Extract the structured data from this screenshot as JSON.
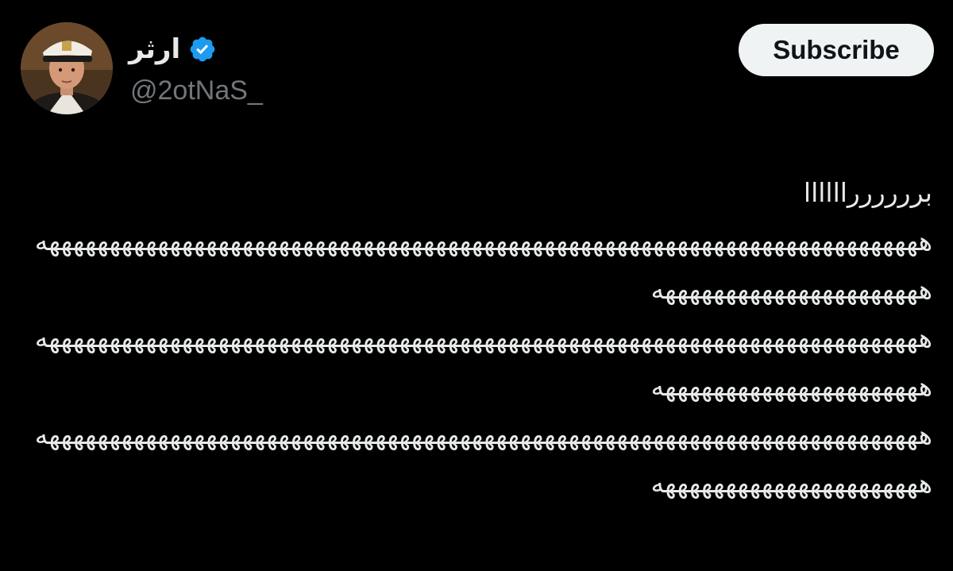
{
  "author": {
    "display_name": "ارثر",
    "handle": "@2otNaS_",
    "verified_icon": "verified-badge-icon",
    "verified_color": "#1d9bf0",
    "avatar_icon": "profile-avatar"
  },
  "actions": {
    "subscribe_label": "Subscribe"
  },
  "tweet": {
    "lines": [
      "برررررراااااا",
      "هههههههههههههههههههههههههههههههههههههههههههههههههههههههههههههههههههههههههه",
      "ههههههههههههههههههههههه",
      "هههههههههههههههههههههههههههههههههههههههههههههههههههههههههههههههههههههههههه",
      "ههههههههههههههههههههههه",
      "هههههههههههههههههههههههههههههههههههههههههههههههههههههههههههههههههههههههههه",
      "ههههههههههههههههههههههه"
    ]
  },
  "colors": {
    "background": "#000000",
    "text_primary": "#e7e9ea",
    "text_secondary": "#71767b",
    "button_bg": "#eff3f4",
    "button_text": "#0f1419"
  }
}
